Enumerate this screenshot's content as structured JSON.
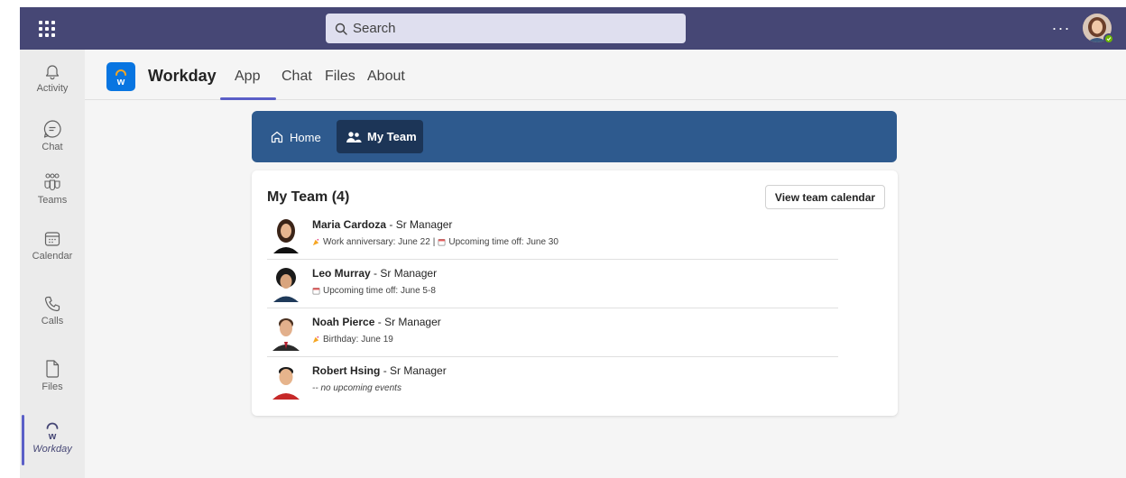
{
  "search": {
    "placeholder": "Search"
  },
  "titlebar": {
    "more_label": "···"
  },
  "rail": {
    "items": [
      {
        "label": "Activity",
        "icon": "bell-icon"
      },
      {
        "label": "Chat",
        "icon": "chat-icon"
      },
      {
        "label": "Teams",
        "icon": "teams-icon"
      },
      {
        "label": "Calendar",
        "icon": "calendar-icon"
      },
      {
        "label": "Calls",
        "icon": "phone-icon"
      },
      {
        "label": "Files",
        "icon": "file-icon"
      },
      {
        "label": "Workday",
        "icon": "workday-icon",
        "active": true
      }
    ]
  },
  "app": {
    "name": "Workday",
    "tabs": [
      {
        "label": "App",
        "active": true
      },
      {
        "label": "Chat"
      },
      {
        "label": "Files"
      },
      {
        "label": "About"
      }
    ]
  },
  "nav": {
    "home_label": "Home",
    "myteam_label": "My Team"
  },
  "team": {
    "title": "My Team (4)",
    "calendar_button": "View team calendar",
    "members": [
      {
        "name": "Maria Cardoza",
        "role": "Sr Manager",
        "events": [
          {
            "icon": "celebration-icon",
            "text": "Work anniversary: June 22"
          },
          {
            "icon": "calendar-event-icon",
            "text": "Upcoming time off: June 30"
          }
        ]
      },
      {
        "name": "Leo Murray",
        "role": "Sr Manager",
        "events": [
          {
            "icon": "calendar-event-icon",
            "text": "Upcoming time off: June 5-8"
          }
        ]
      },
      {
        "name": "Noah Pierce",
        "role": "Sr Manager",
        "events": [
          {
            "icon": "celebration-icon",
            "text": "Birthday: June 19"
          }
        ]
      },
      {
        "name": "Robert Hsing",
        "role": "Sr Manager",
        "none_text": "-- no upcoming events"
      }
    ]
  },
  "colors": {
    "titlebar": "#464775",
    "accent": "#5b5fc7",
    "nav_bar": "#2e5a8e",
    "nav_active": "#1c3557",
    "workday_blue": "#0875e1",
    "workday_orange": "#f5a623"
  }
}
